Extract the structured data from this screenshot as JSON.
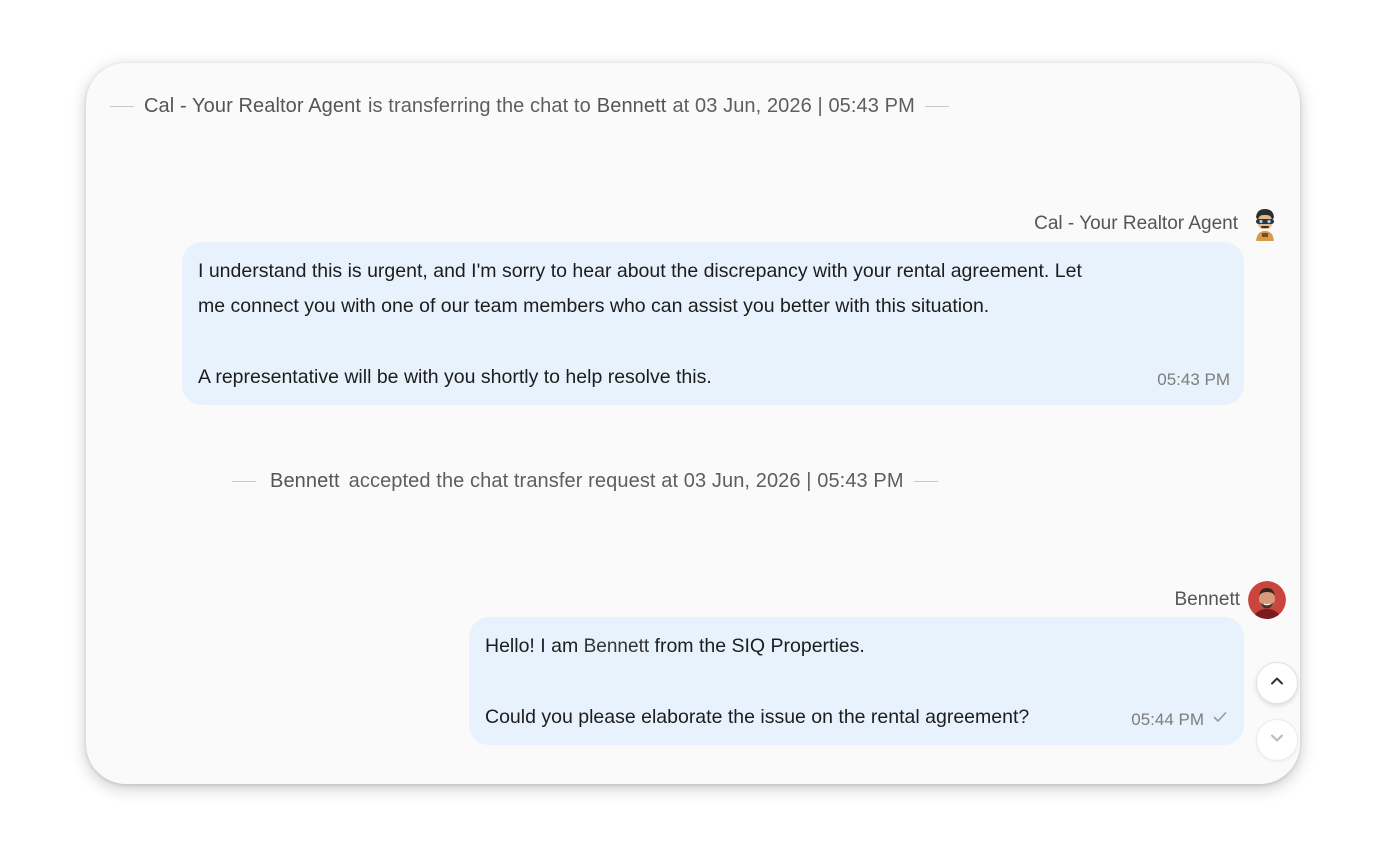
{
  "system_messages": {
    "transfer": {
      "agent": "Cal - Your Realtor Agent",
      "text": "is transferring the chat to",
      "target": "Bennett",
      "suffix": "at 03 Jun, 2026 | 05:43 PM"
    },
    "accepted": {
      "agent": "Bennett",
      "text": "accepted the chat transfer request at 03 Jun, 2026 | 05:43 PM"
    }
  },
  "messages": [
    {
      "sender": "Cal - Your Realtor Agent",
      "avatar_icon": "robot-agent-avatar",
      "line1": "I understand this is urgent, and I'm sorry to hear about the discrepancy with your rental agreement. Let",
      "line2": "me connect you with one of our team members who can assist you better with this situation.",
      "line3": "A representative will be with you shortly to help resolve this.",
      "time": "05:43 PM"
    },
    {
      "sender": "Bennett",
      "avatar_icon": "person-avatar",
      "line1_pre": "Hello! I am",
      "line1_name": "Bennett",
      "line1_post": "from the SIQ Properties.",
      "line2": "Could you please elaborate the issue on the rental agreement?",
      "time": "05:44 PM",
      "status_icon": "check-icon"
    }
  ],
  "controls": {
    "scroll_up_icon": "chevron-up-icon",
    "scroll_down_icon": "chevron-down-icon"
  },
  "colors": {
    "bubble": "#e7f2fc",
    "background": "#fafafa"
  }
}
